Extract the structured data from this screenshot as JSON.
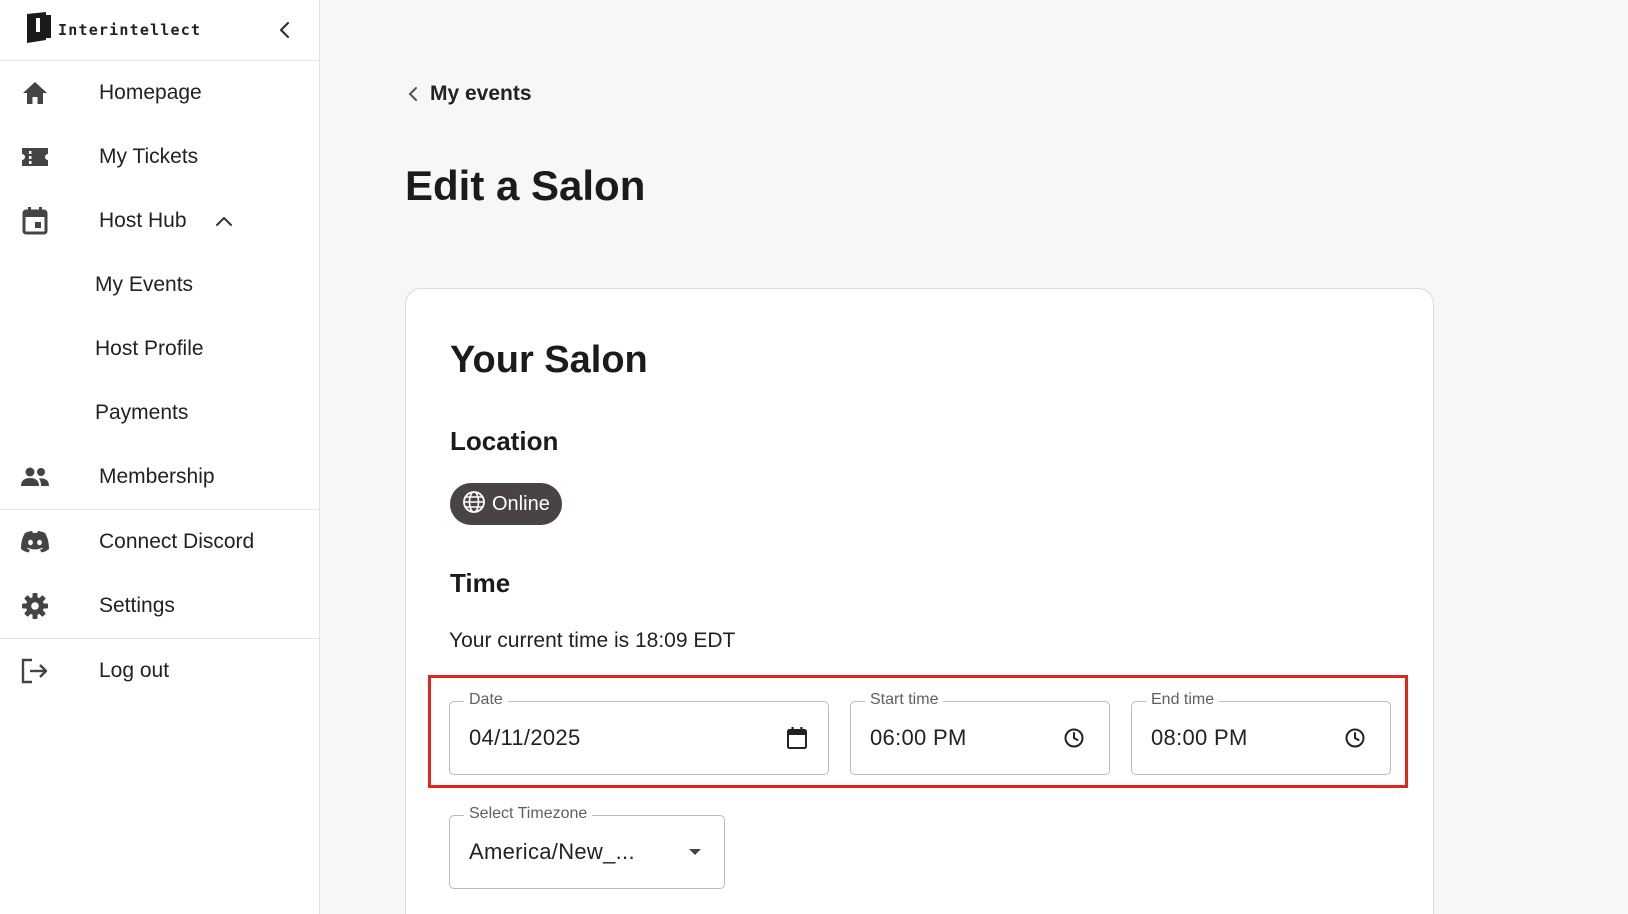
{
  "brand": {
    "name": "Interintellect"
  },
  "sidebar": {
    "items": [
      {
        "label": "Homepage",
        "icon": "home-icon"
      },
      {
        "label": "My Tickets",
        "icon": "ticket-icon"
      },
      {
        "label": "Host Hub",
        "icon": "calendar-icon",
        "expanded": true
      },
      {
        "label": "My Events"
      },
      {
        "label": "Host Profile"
      },
      {
        "label": "Payments"
      },
      {
        "label": "Membership",
        "icon": "people-icon"
      },
      {
        "label": "Connect Discord",
        "icon": "discord-icon"
      },
      {
        "label": "Settings",
        "icon": "gear-icon"
      },
      {
        "label": "Log out",
        "icon": "logout-icon"
      }
    ]
  },
  "breadcrumb": {
    "label": "My events"
  },
  "page": {
    "title": "Edit a Salon"
  },
  "card": {
    "title": "Your Salon",
    "location": {
      "heading": "Location",
      "chip_label": "Online",
      "chip_icon": "globe-icon"
    },
    "time": {
      "heading": "Time",
      "current_time_text": "Your current time is 18:09 EDT",
      "date": {
        "label": "Date",
        "value": "04/11/2025",
        "icon": "calendar-icon"
      },
      "start": {
        "label": "Start time",
        "value": "06:00 PM",
        "icon": "clock-icon"
      },
      "end": {
        "label": "End time",
        "value": "08:00 PM",
        "icon": "clock-icon"
      },
      "timezone": {
        "label": "Select Timezone",
        "value": "America/New_...",
        "icon": "caret-down-icon"
      }
    }
  },
  "colors": {
    "highlight": "#e0251b",
    "chip_bg": "#4a4344",
    "background": "#f7f7f7"
  }
}
